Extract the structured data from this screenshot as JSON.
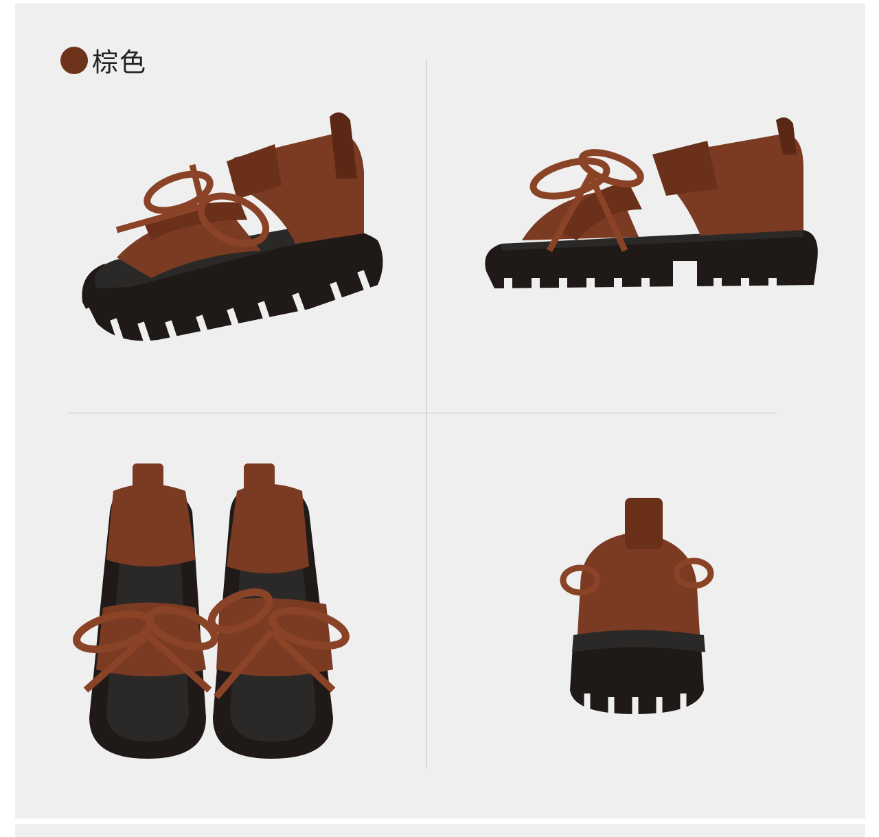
{
  "color_label": {
    "text": "棕色",
    "swatch_color": "#6e341b"
  },
  "colors": {
    "leather": "#7a3b22",
    "leather_dark": "#5a2814",
    "lace": "#8a4326",
    "sole": "#1f1a18",
    "footbed": "#2b2928"
  },
  "photos": [
    {
      "view": "front-three-quarter"
    },
    {
      "view": "side"
    },
    {
      "view": "top-pair"
    },
    {
      "view": "rear"
    }
  ]
}
